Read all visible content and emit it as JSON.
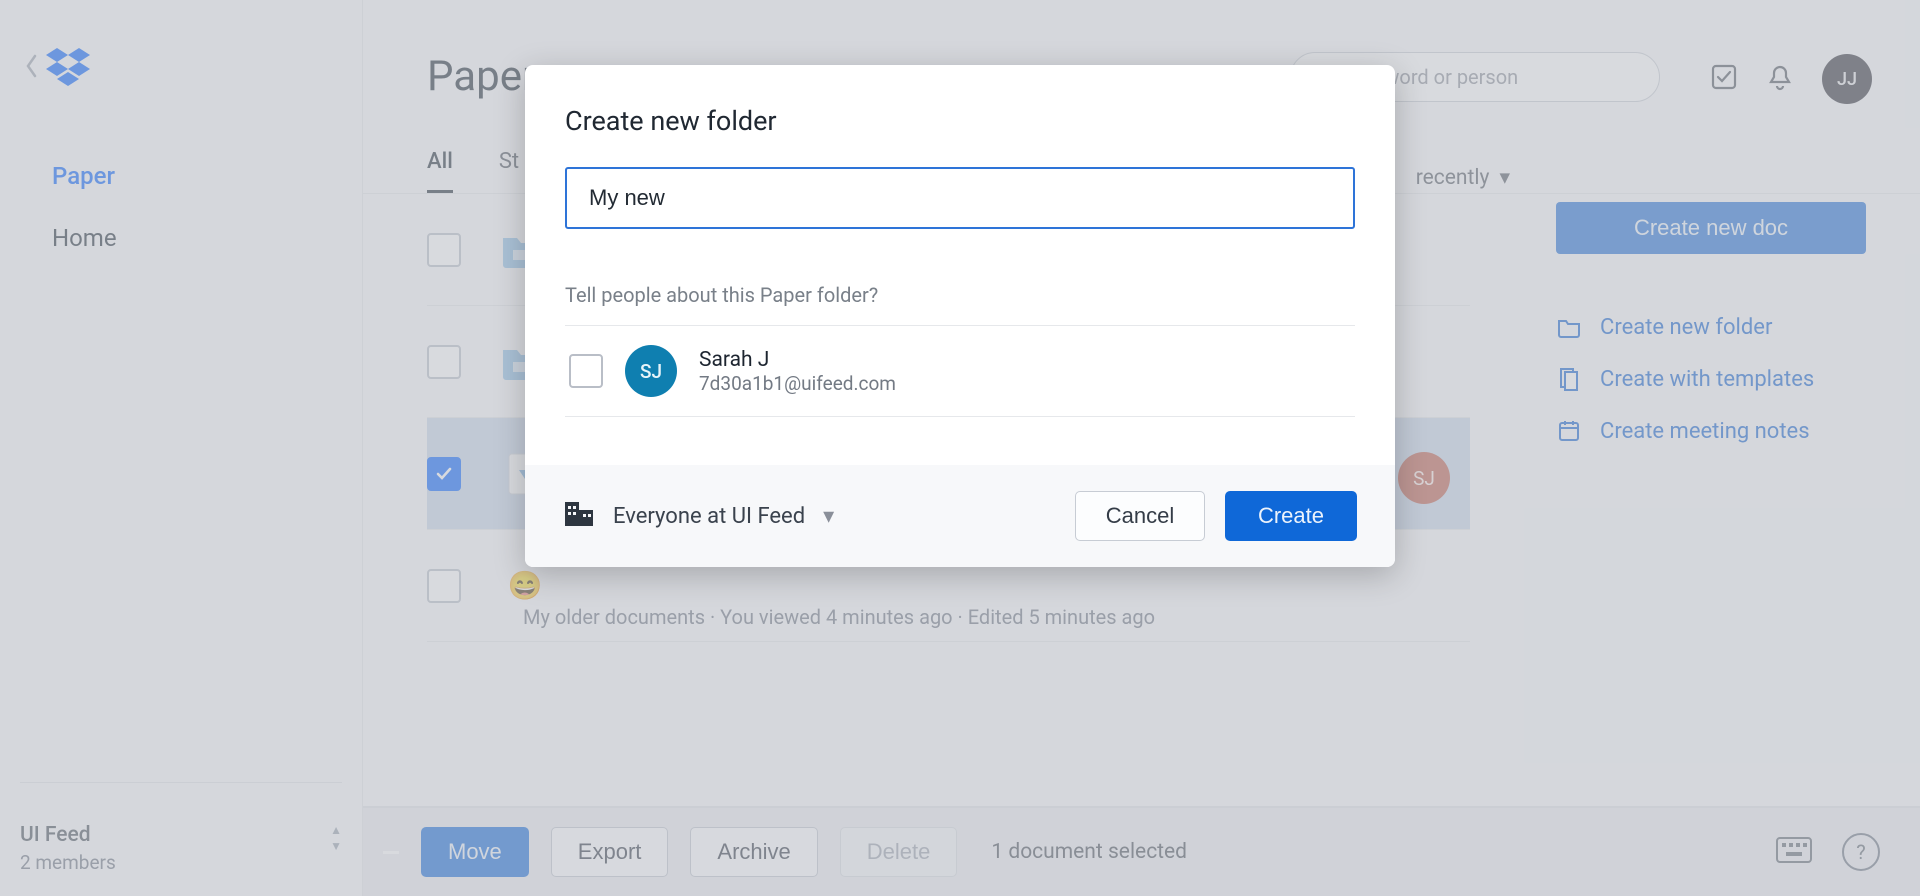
{
  "sidebar": {
    "nav": {
      "paper": "Paper",
      "home": "Home"
    },
    "org_name": "UI Feed",
    "org_sub": "2 members"
  },
  "header": {
    "page_title_truncated": "Paper",
    "search_placeholder_truncated": "h by keyword or person",
    "avatar_initials": "JJ"
  },
  "tabs": {
    "all": "All",
    "second_truncated": "St",
    "sort_truncated": " recently"
  },
  "right_panel": {
    "create_doc": "Create new doc",
    "create_folder": "Create new folder",
    "create_templates": "Create with templates",
    "create_meeting": "Create meeting notes"
  },
  "rows": {
    "selected_avatar": "SJ",
    "my_older": {
      "emoji": "😄",
      "meta": "My older documents · You viewed 4 minutes ago · Edited 5 minutes ago"
    }
  },
  "sel_bar": {
    "move": "Move",
    "export": "Export",
    "archive": "Archive",
    "delete": "Delete",
    "status": "1 document selected"
  },
  "modal": {
    "title": "Create new folder",
    "input_value": "My new",
    "tell_people": "Tell people about this Paper folder?",
    "person_initials": "SJ",
    "person_name": "Sarah J",
    "person_email": "7d30a1b1@uifeed.com",
    "audience": "Everyone at UI Feed",
    "cancel": "Cancel",
    "create": "Create"
  }
}
